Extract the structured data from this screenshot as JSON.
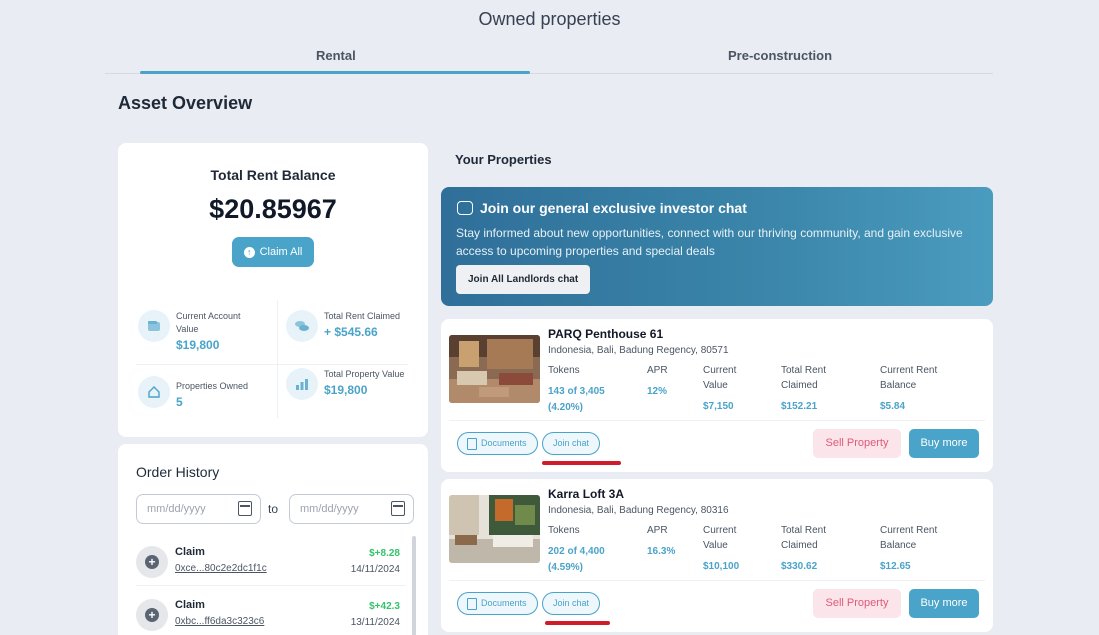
{
  "page_title": "Owned properties",
  "tabs": [
    {
      "label": "Rental",
      "active": true
    },
    {
      "label": "Pre-construction",
      "active": false
    }
  ],
  "asset_overview": {
    "title": "Asset Overview",
    "balance_label": "Total Rent Balance",
    "balance_value": "$20.85967",
    "claim_all_label": "Claim All",
    "stats": [
      {
        "label": "Current Account Value",
        "value": "$19,800",
        "icon": "wallet-icon"
      },
      {
        "label": "Total Rent Claimed",
        "value": "+ $545.66",
        "icon": "coins-icon"
      },
      {
        "label": "Properties Owned",
        "value": "5",
        "icon": "home-icon"
      },
      {
        "label": "Total Property Value",
        "value": "$19,800",
        "icon": "bar-chart-icon"
      }
    ]
  },
  "order_history": {
    "title": "Order History",
    "date_placeholder": "mm/dd/yyyy",
    "to_label": "to",
    "rows": [
      {
        "type": "Claim",
        "hash": "0xce...80c2e2dc1f1c",
        "amount": "$+8.28",
        "date": "14/11/2024"
      },
      {
        "type": "Claim",
        "hash": "0xbc...ff6da3c323c6",
        "amount": "$+42.3",
        "date": "13/11/2024"
      }
    ]
  },
  "your_properties": {
    "title": "Your Properties",
    "banner": {
      "title": "Join our general exclusive investor chat",
      "text": "Stay informed about new opportunities, connect with our thriving community, and gain exclusive access to upcoming properties and special deals",
      "button_label": "Join All Landlords chat"
    },
    "column_labels": {
      "tokens": "Tokens",
      "apr": "APR",
      "current_value": "Current Value",
      "total_rent_claimed": "Total Rent Claimed",
      "current_rent_balance": "Current Rent Balance"
    },
    "properties": [
      {
        "name": "PARQ Penthouse 61",
        "address": "Indonesia, Bali, Badung Regency, 80571",
        "tokens": "143 of 3,405 (4.20%)",
        "apr": "12%",
        "current_value": "$7,150",
        "total_rent_claimed": "$152.21",
        "current_rent_balance": "$5.84"
      },
      {
        "name": "Karra Loft 3A",
        "address": "Indonesia, Bali, Badung Regency, 80316",
        "tokens": "202 of 4,400 (4.59%)",
        "apr": "16.3%",
        "current_value": "$10,100",
        "total_rent_claimed": "$330.62",
        "current_rent_balance": "$12.65"
      }
    ],
    "actions": {
      "documents": "Documents",
      "join_chat": "Join chat",
      "sell": "Sell Property",
      "buy": "Buy more"
    }
  },
  "colors": {
    "accent": "#4aa3c8",
    "positive": "#34c26a",
    "sell": "#e05a78",
    "highlight": "#d01c2a",
    "background": "#e9ecf2"
  }
}
